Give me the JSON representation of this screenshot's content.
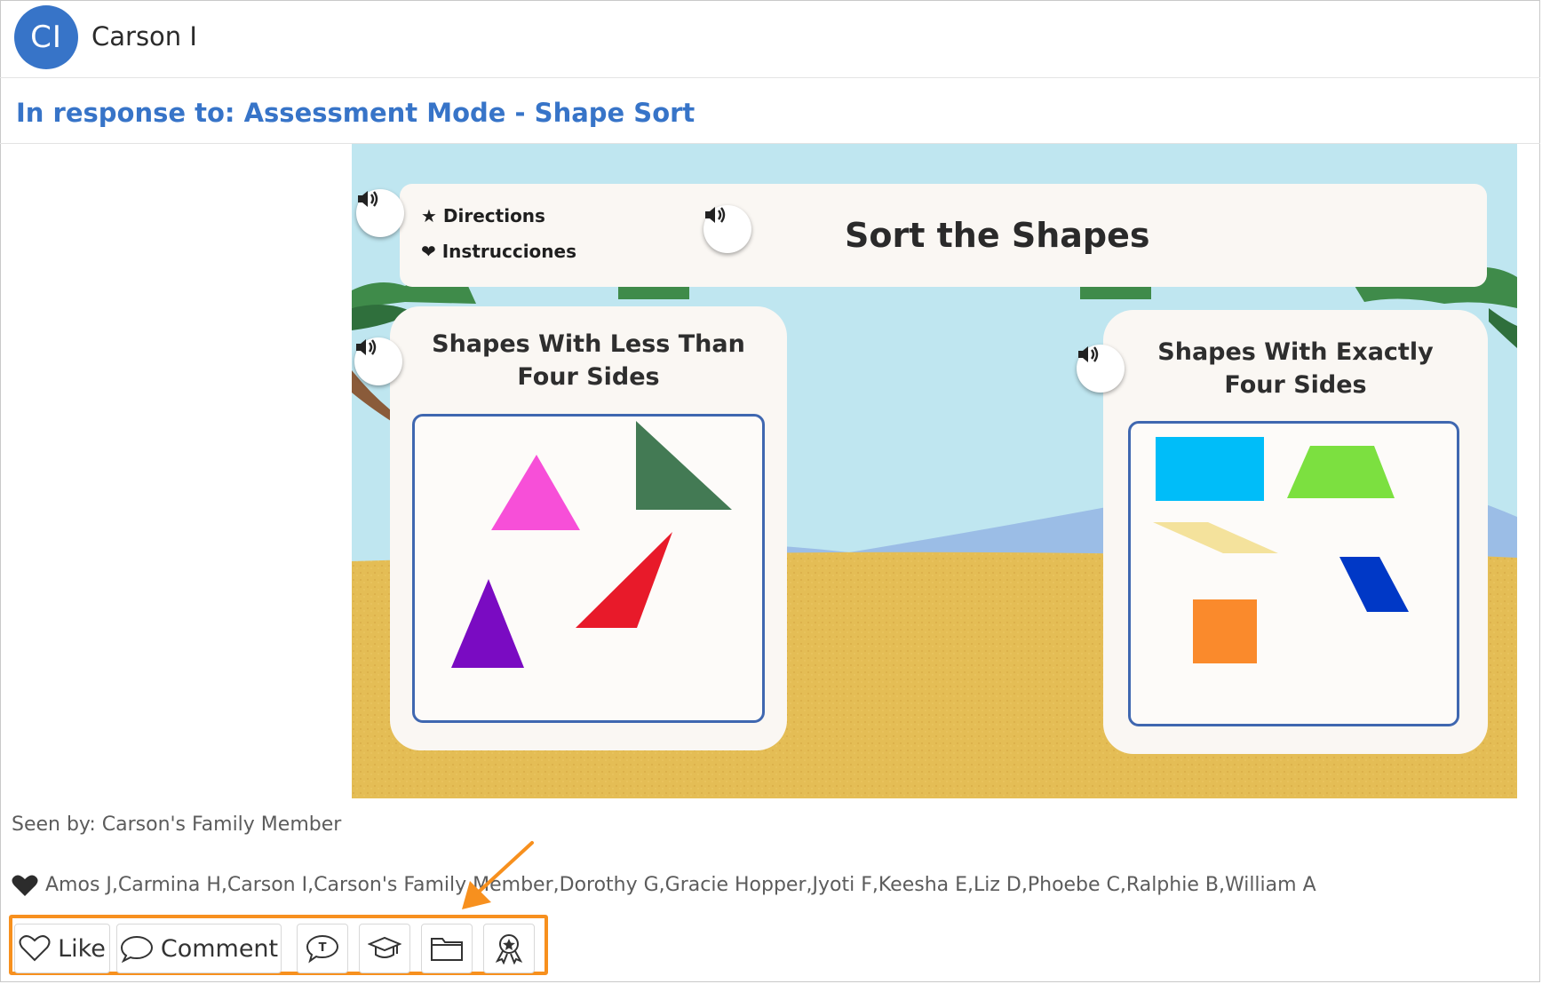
{
  "user": {
    "initials": "CI",
    "name": "Carson I",
    "avatar_color": "#3774c8"
  },
  "response": {
    "text": "In response to: Assessment Mode - Shape Sort",
    "color": "#3774c8"
  },
  "activity": {
    "directions_label": "Directions",
    "instructions_label": "Instrucciones",
    "title": "Sort the Shapes",
    "left_heading_line1": "Shapes With Less Than",
    "left_heading_line2": "Four Sides",
    "right_heading_line1": "Shapes With Exactly",
    "right_heading_line2": "Four Sides",
    "left_shapes": [
      "pink triangle",
      "green right triangle",
      "red triangle",
      "purple triangle"
    ],
    "right_shapes": [
      "blue rectangle",
      "green trapezoid",
      "yellow parallelogram",
      "blue parallelogram",
      "orange square"
    ]
  },
  "seen": {
    "text": "Seen by: Carson's Family Member"
  },
  "likes": {
    "text": "Amos J,Carmina H,Carson I,Carson's Family Member,Dorothy G,Gracie Hopper,Jyoti F,Keesha E,Liz D,Phoebe C,Ralphie B,William A"
  },
  "actions": {
    "like_label": "Like",
    "comment_label": "Comment",
    "icons": [
      "heart-icon",
      "comment-icon",
      "teacher-comment-icon",
      "graduation-cap-icon",
      "folder-icon",
      "award-badge-icon"
    ]
  },
  "colors": {
    "highlight": "#f7901e"
  }
}
